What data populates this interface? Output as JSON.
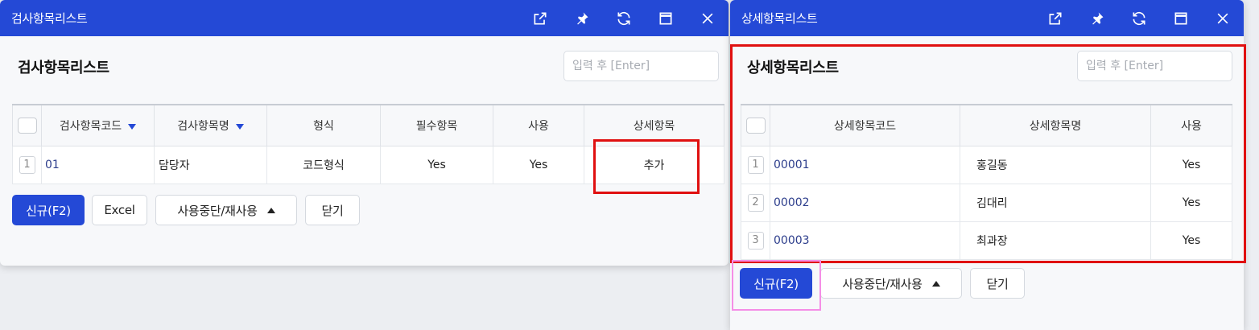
{
  "left_window": {
    "title": "검사항목리스트",
    "heading": "검사항목리스트",
    "search_placeholder": "입력 후 [Enter]",
    "columns": [
      "검사항목코드",
      "검사항목명",
      "형식",
      "필수항목",
      "사용",
      "상세항목"
    ],
    "rows": [
      {
        "num": "1",
        "code": "01",
        "name": "담당자",
        "type": "코드형식",
        "required": "Yes",
        "use": "Yes",
        "detail": "추가"
      }
    ],
    "buttons": {
      "new": "신규(F2)",
      "excel": "Excel",
      "suspend": "사용중단/재사용",
      "close": "닫기"
    }
  },
  "right_window": {
    "title": "상세항목리스트",
    "heading": "상세항목리스트",
    "search_placeholder": "입력 후 [Enter]",
    "columns": [
      "상세항목코드",
      "상세항목명",
      "사용"
    ],
    "rows": [
      {
        "num": "1",
        "code": "00001",
        "name": "홍길동",
        "use": "Yes"
      },
      {
        "num": "2",
        "code": "00002",
        "name": "김대리",
        "use": "Yes"
      },
      {
        "num": "3",
        "code": "00003",
        "name": "최과장",
        "use": "Yes"
      }
    ],
    "buttons": {
      "new": "신규(F2)",
      "suspend": "사용중단/재사용",
      "close": "닫기"
    }
  },
  "title_icons": [
    "external-link-icon",
    "pin-icon",
    "refresh-icon",
    "maximize-icon",
    "close-icon"
  ],
  "colors": {
    "accent": "#2449d6",
    "highlight_red": "#e01010",
    "highlight_pink": "#f58ee6"
  }
}
